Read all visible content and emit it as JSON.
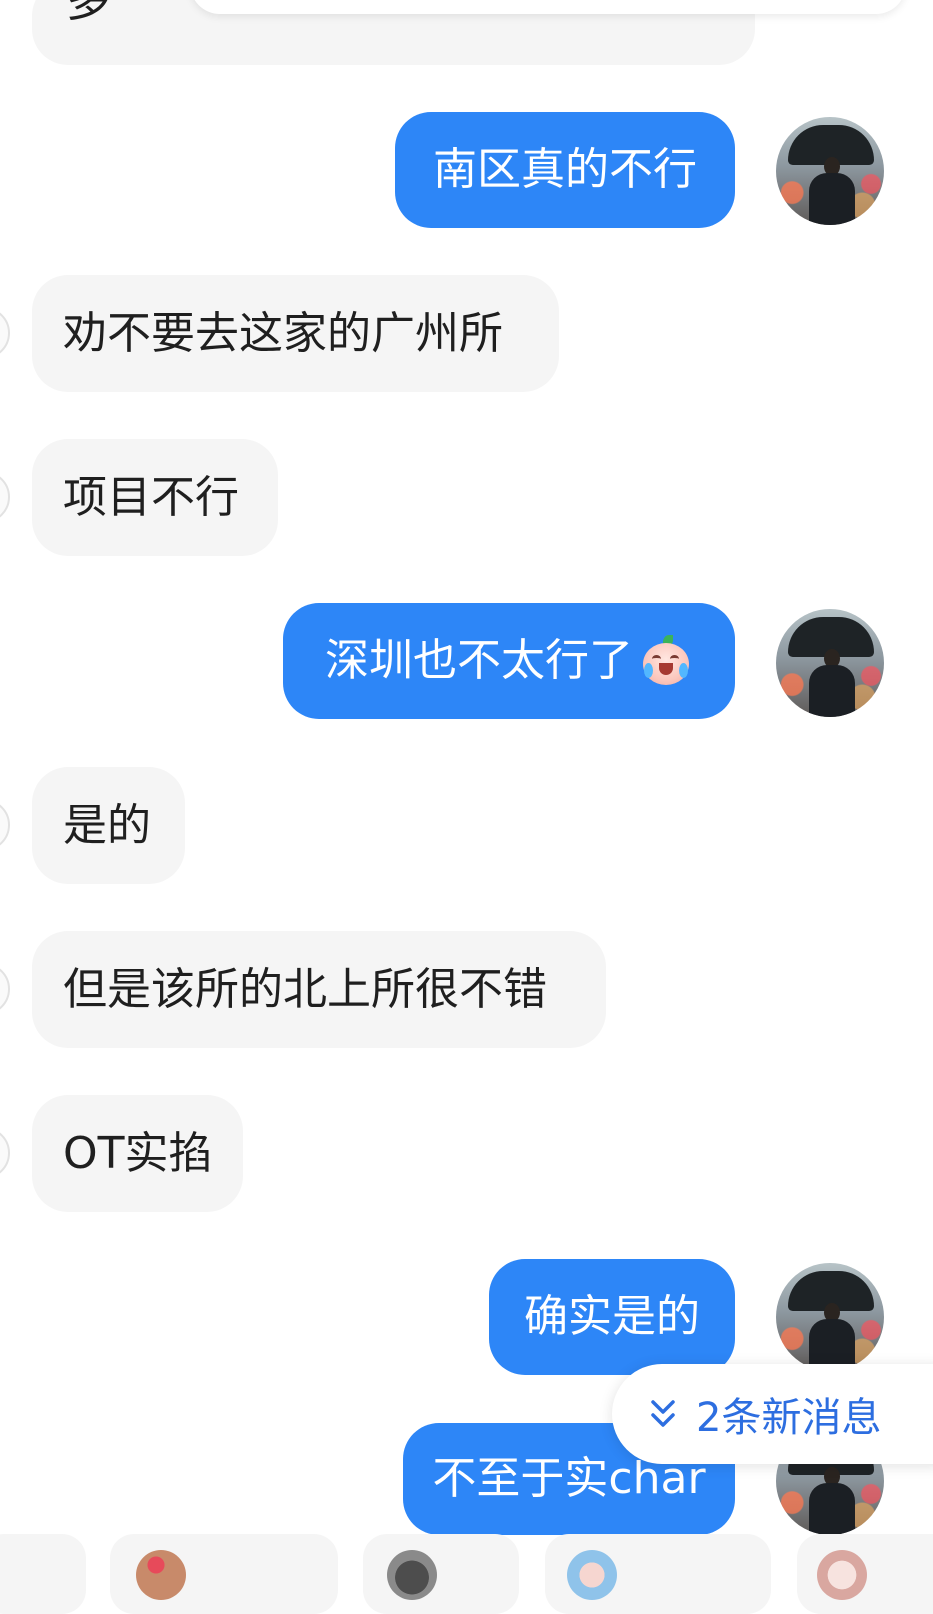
{
  "top_partial": {
    "glyph": "多"
  },
  "messages": [
    {
      "side": "out",
      "text": "南区真的不行"
    },
    {
      "side": "in",
      "text": "劝不要去这家的广州所"
    },
    {
      "side": "in",
      "text": "项目不行"
    },
    {
      "side": "out",
      "text": "深圳也不太行了",
      "emoji": "crying-laughing-peach-emoji"
    },
    {
      "side": "in",
      "text": "是的"
    },
    {
      "side": "in",
      "text": "但是该所的北上所很不错"
    },
    {
      "side": "in",
      "text": "OT实掐"
    },
    {
      "side": "out",
      "text": "确实是的"
    },
    {
      "side": "out",
      "text": "不至于实char"
    }
  ],
  "new_messages_button": {
    "label": "2条新消息",
    "icon": "double-chevron-down-icon"
  },
  "colors": {
    "outgoing_bubble": "#2d86f7",
    "incoming_bubble": "#f5f5f5",
    "accent_text": "#2d6ee0"
  }
}
